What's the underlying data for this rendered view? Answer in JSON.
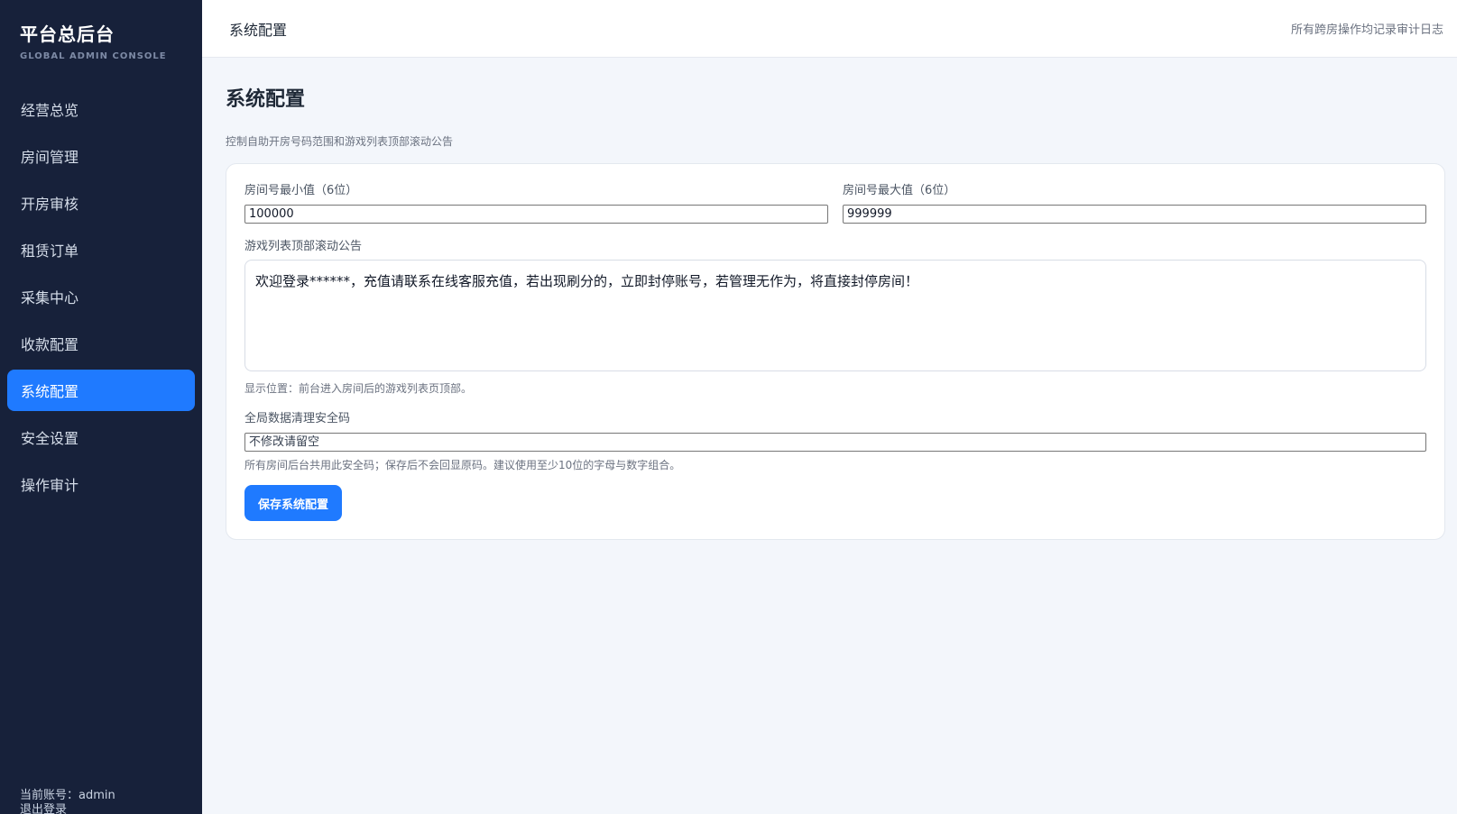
{
  "sidebar": {
    "title": "平台总后台",
    "subtitle": "GLOBAL ADMIN CONSOLE",
    "items": [
      {
        "label": "经营总览"
      },
      {
        "label": "房间管理"
      },
      {
        "label": "开房审核"
      },
      {
        "label": "租赁订单"
      },
      {
        "label": "采集中心"
      },
      {
        "label": "收款配置"
      },
      {
        "label": "系统配置",
        "active": true
      },
      {
        "label": "安全设置"
      },
      {
        "label": "操作审计"
      }
    ],
    "account_text": "当前账号：admin",
    "logout_text": "退出登录"
  },
  "topbar": {
    "title": "系统配置",
    "audit_link": "所有跨房操作均记录审计日志"
  },
  "page": {
    "title": "系统配置",
    "description": "控制自助开房号码范围和游戏列表顶部滚动公告"
  },
  "form": {
    "min_label": "房间号最小值（6位）",
    "min_value": "100000",
    "max_label": "房间号最大值（6位）",
    "max_value": "999999",
    "notice_label": "游戏列表顶部滚动公告",
    "notice_value": "欢迎登录******，充值请联系在线客服充值，若出现刷分的，立即封停账号，若管理无作为，将直接封停房间！",
    "notice_hint": "显示位置：前台进入房间后的游戏列表页顶部。",
    "security_label": "全局数据清理安全码",
    "security_placeholder": "不修改请留空",
    "security_hint": "所有房间后台共用此安全码；保存后不会回显原码。建议使用至少10位的字母与数字组合。",
    "save_label": "保存系统配置"
  },
  "colors": {
    "sidebar_bg": "#17213a",
    "accent": "#1f7aff",
    "page_bg": "#f3f6fb"
  }
}
